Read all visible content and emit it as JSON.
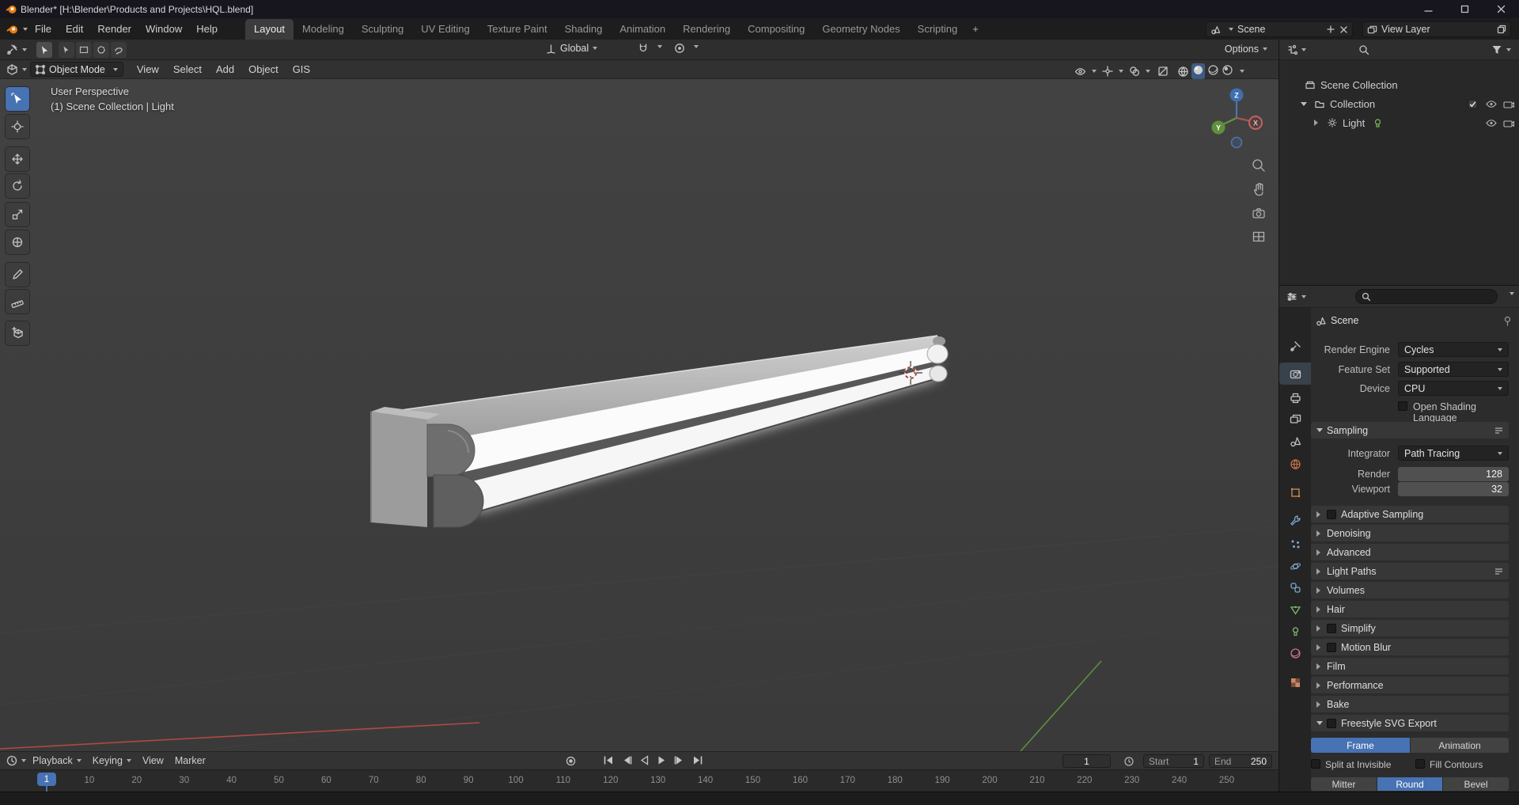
{
  "window": {
    "title": "Blender* [H:\\Blender\\Products and Projects\\HQL.blend]"
  },
  "topbar": {
    "menus": [
      "File",
      "Edit",
      "Render",
      "Window",
      "Help"
    ],
    "tabs": [
      "Layout",
      "Modeling",
      "Sculpting",
      "UV Editing",
      "Texture Paint",
      "Shading",
      "Animation",
      "Rendering",
      "Compositing",
      "Geometry Nodes",
      "Scripting"
    ],
    "add_tab": "+",
    "scene_label": "Scene",
    "view_layer_label": "View Layer"
  },
  "tool_settings": {
    "orientation": "Global",
    "options_label": "Options"
  },
  "viewport": {
    "header": {
      "mode": "Object Mode",
      "view": "View",
      "select": "Select",
      "add": "Add",
      "object": "Object",
      "gis": "GIS"
    },
    "overlay": {
      "line1": "User Perspective",
      "line2": "(1) Scene Collection | Light"
    },
    "gizmo": {
      "x": "X",
      "y": "Y",
      "z": "Z"
    }
  },
  "outliner": {
    "root": "Scene Collection",
    "collection": "Collection",
    "light": "Light"
  },
  "properties": {
    "breadcrumb": "Scene",
    "render_engine_label": "Render Engine",
    "render_engine": "Cycles",
    "feature_set_label": "Feature Set",
    "feature_set": "Supported",
    "device_label": "Device",
    "device": "CPU",
    "osl_label": "Open Shading Language",
    "sampling_label": "Sampling",
    "integrator_label": "Integrator",
    "integrator": "Path Tracing",
    "render_label": "Render",
    "render_samples": "128",
    "viewport_label": "Viewport",
    "viewport_samples": "32",
    "sections": [
      {
        "label": "Adaptive Sampling"
      },
      {
        "label": "Denoising"
      },
      {
        "label": "Advanced"
      },
      {
        "label": "Light Paths"
      },
      {
        "label": "Volumes"
      },
      {
        "label": "Hair"
      },
      {
        "label": "Simplify"
      },
      {
        "label": "Motion Blur"
      },
      {
        "label": "Film"
      },
      {
        "label": "Performance"
      },
      {
        "label": "Bake"
      }
    ],
    "freestyle": {
      "label": "Freestyle SVG Export",
      "frame": "Frame",
      "animation": "Animation",
      "split": "Split at Invisible",
      "fill": "Fill Contours",
      "mitter": "Mitter",
      "round": "Round",
      "bevel": "Bevel"
    }
  },
  "timeline": {
    "playback": "Playback",
    "keying": "Keying",
    "view": "View",
    "marker": "Marker",
    "current_frame": "1",
    "start_label": "Start",
    "start_value": "1",
    "end_label": "End",
    "end_value": "250",
    "ruler_frames": [
      10,
      20,
      30,
      40,
      50,
      60,
      70,
      80,
      90,
      100,
      110,
      120,
      130,
      140,
      150,
      160,
      170,
      180,
      190,
      200,
      210,
      220,
      230,
      240,
      250
    ]
  },
  "colors": {
    "accent": "#4772b3",
    "axis_x": "#b04a45",
    "axis_y": "#5f8f3d",
    "axis_z": "#3f6fae"
  }
}
